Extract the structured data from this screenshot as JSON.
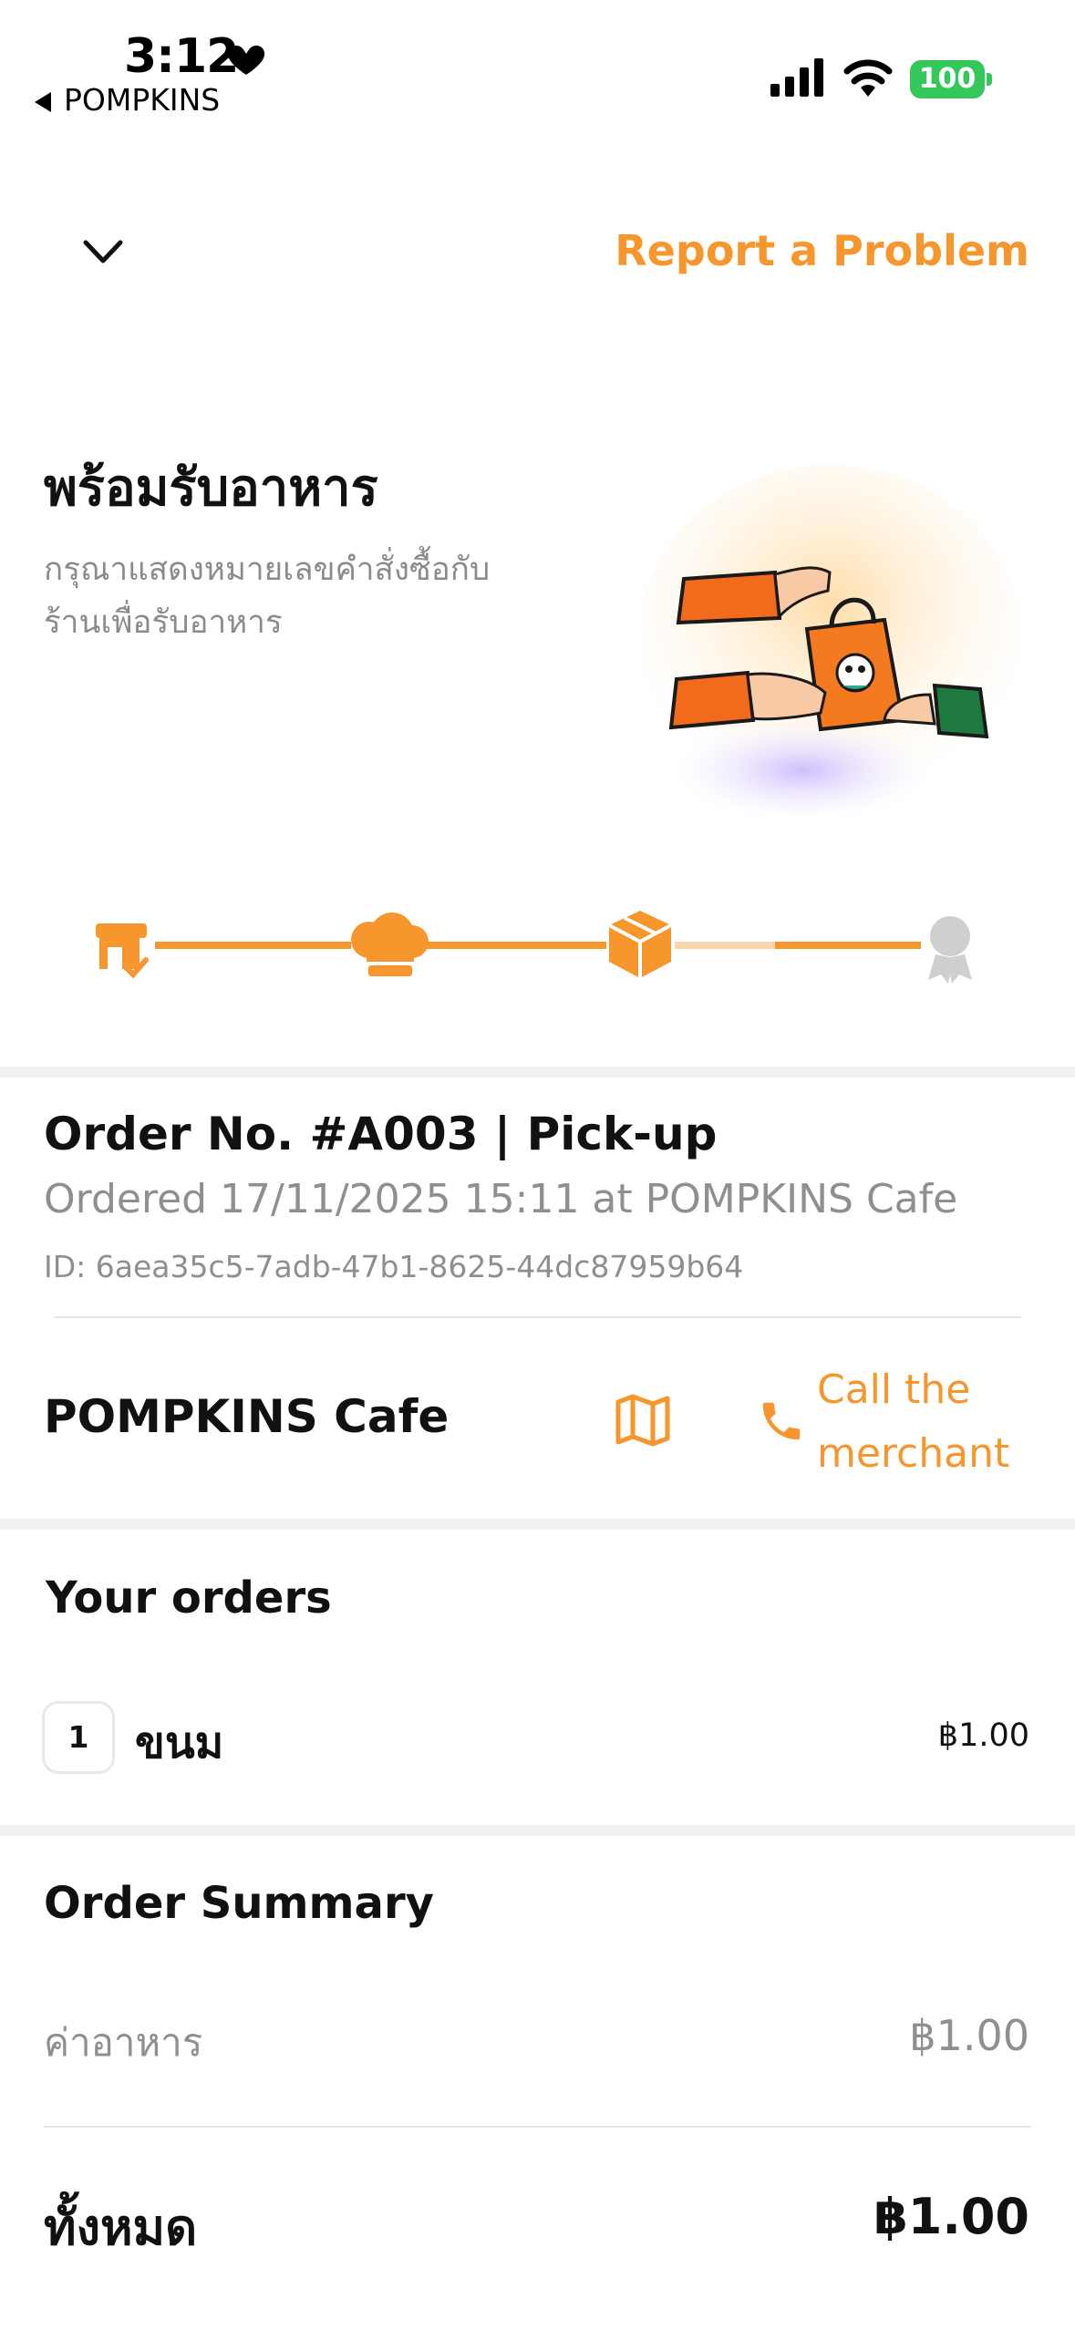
{
  "status_bar": {
    "time": "3:12",
    "back_app": "POMPKINS",
    "battery": "100",
    "icons": [
      "heart-icon",
      "signal-icon",
      "wifi-icon",
      "battery-icon"
    ]
  },
  "header": {
    "collapse_icon": "chevron-down-icon",
    "report_label": "Report a Problem"
  },
  "hero": {
    "title": "พร้อมรับอาหาร",
    "subtitle_line1": "กรุณาแสดงหมายเลขคำสั่งซื้อกับ",
    "subtitle_line2": "ร้านเพื่อรับอาหาร"
  },
  "progress": {
    "steps": [
      "store-check-icon",
      "chef-hat-icon",
      "package-icon",
      "award-icon"
    ],
    "current_step": 3,
    "total_steps": 4
  },
  "order": {
    "number": "Order No. #A003 | Pick-up",
    "ordered": "Ordered  17/11/2025 15:11  at POMPKINS Cafe",
    "id": "ID: 6aea35c5-7adb-47b1-8625-44dc87959b64"
  },
  "merchant": {
    "name": "POMPKINS Cafe",
    "call_line1": "Call the",
    "call_line2": "merchant"
  },
  "your_orders": {
    "title": "Your orders",
    "items": [
      {
        "qty": "1",
        "name": "ขนม",
        "price": "฿1.00"
      }
    ]
  },
  "summary": {
    "title": "Order Summary",
    "food_label": "ค่าอาหาร",
    "food_value": "฿1.00",
    "total_label": "ทั้งหมด",
    "total_value": "฿1.00"
  },
  "colors": {
    "accent": "#f7962c",
    "muted": "#8f8f8f",
    "battery": "#34c759"
  }
}
